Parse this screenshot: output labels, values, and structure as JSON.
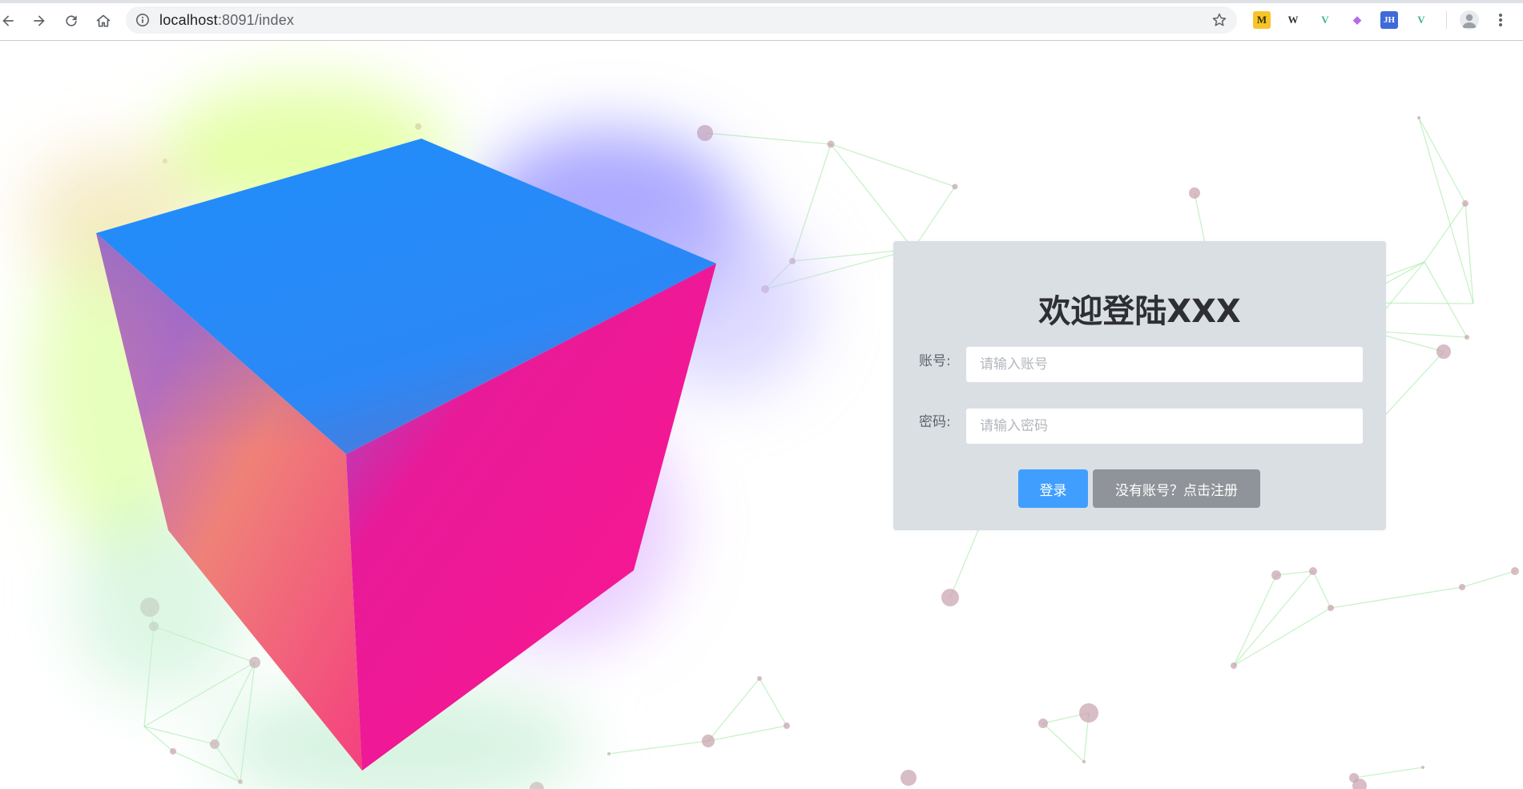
{
  "browser": {
    "url_host": "localhost",
    "url_path": ":8091/index",
    "extensions": [
      {
        "name": "m-extension-icon",
        "glyph": "M",
        "bg": "#f7c52b",
        "fg": "#3a2e00"
      },
      {
        "name": "wikipedia-extension-icon",
        "glyph": "W",
        "bg": "#ffffff",
        "fg": "#333333"
      },
      {
        "name": "vue-devtools-extension-icon",
        "glyph": "V",
        "bg": "#ffffff",
        "fg": "#41b883"
      },
      {
        "name": "color-picker-extension-icon",
        "glyph": "◆",
        "bg": "#ffffff",
        "fg": "#b16bf0"
      },
      {
        "name": "jh-extension-icon",
        "glyph": "JH",
        "bg": "#3f6ad8",
        "fg": "#ffffff"
      },
      {
        "name": "vue-extension-icon",
        "glyph": "V",
        "bg": "#ffffff",
        "fg": "#41b883"
      }
    ]
  },
  "login": {
    "title": "欢迎登陆XXX",
    "account_label": "账号:",
    "account_placeholder": "请输入账号",
    "account_value": "",
    "password_label": "密码:",
    "password_placeholder": "请输入密码",
    "password_value": "",
    "login_button": "登录",
    "register_button": "没有账号？点击注册"
  },
  "colors": {
    "primary": "#409eff",
    "info": "#909399",
    "panel_bg": "#dadfe4",
    "cube_top": "#1f8efa",
    "cube_right": "#ff1590",
    "cube_left": "#f07e7a"
  }
}
